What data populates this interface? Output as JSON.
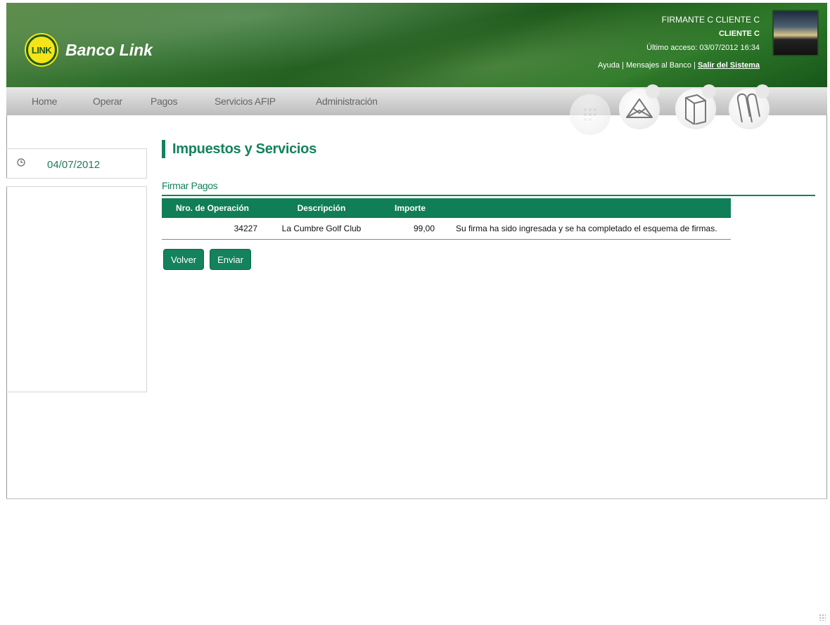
{
  "brand": {
    "logo_text": "LINK",
    "name": "Banco Link",
    "header_color": "#2f6f2c",
    "accent": "#13825d"
  },
  "user": {
    "signer": "FIRMANTE C CLIENTE C",
    "client": "CLIENTE C",
    "last_access": "Último acceso: 03/07/2012 16:34"
  },
  "header_links": {
    "ayuda": "Ayuda",
    "sep1": "|",
    "mensajes": "Mensajes al Banco",
    "sep2": "|",
    "salir": "Salir del Sistema"
  },
  "nav": {
    "items": [
      "Home",
      "Operar",
      "Pagos",
      "Servicios AFIP",
      "Administración"
    ],
    "icons": [
      "calendar-icon",
      "envelope-icon",
      "folder-icon",
      "paperclip-icon"
    ]
  },
  "sidebar": {
    "date": "04/07/2012"
  },
  "main": {
    "page_title": "Impuestos y Servicios",
    "section_title": "Firmar Pagos",
    "table": {
      "headers": [
        "Nro. de Operación",
        "Descripción",
        "Importe",
        ""
      ],
      "rows": [
        {
          "operation": "34227",
          "description": "La Cumbre Golf Club",
          "amount": "99,00",
          "message": "Su firma ha sido ingresada y se ha completado el esquema de firmas."
        }
      ]
    },
    "buttons": {
      "back": "Volver",
      "send": "Enviar"
    }
  }
}
